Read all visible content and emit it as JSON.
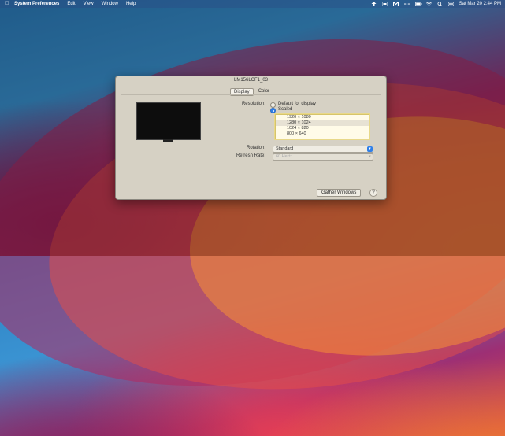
{
  "menubar": {
    "apple_glyph": "",
    "app_name": "System Preferences",
    "items": [
      "Edit",
      "View",
      "Window",
      "Help"
    ],
    "clock": "Sat Mar 20  2:44 PM"
  },
  "window": {
    "title": "LM156LCF1_03",
    "tabs": [
      "Display",
      "Color"
    ],
    "selected_tab": "Display",
    "resolution_label": "Resolution:",
    "resolution_options": [
      "Default for display",
      "Scaled"
    ],
    "resolution_selected": "Scaled",
    "scaled_resolutions": [
      "1920 × 1080",
      "1280 × 1024",
      "1024 × 820",
      "800 × 640"
    ],
    "scaled_selected": "1280 × 1024",
    "rotation_label": "Rotation:",
    "rotation_value": "Standard",
    "refresh_label": "Refresh Rate:",
    "refresh_value": "60 Hertz",
    "gather_button": "Gather Windows",
    "help_button": "?"
  },
  "colors": {
    "accent": "#2f7fe8",
    "window_bg": "#d6d1c4",
    "list_highlight": "#d6c46a"
  }
}
